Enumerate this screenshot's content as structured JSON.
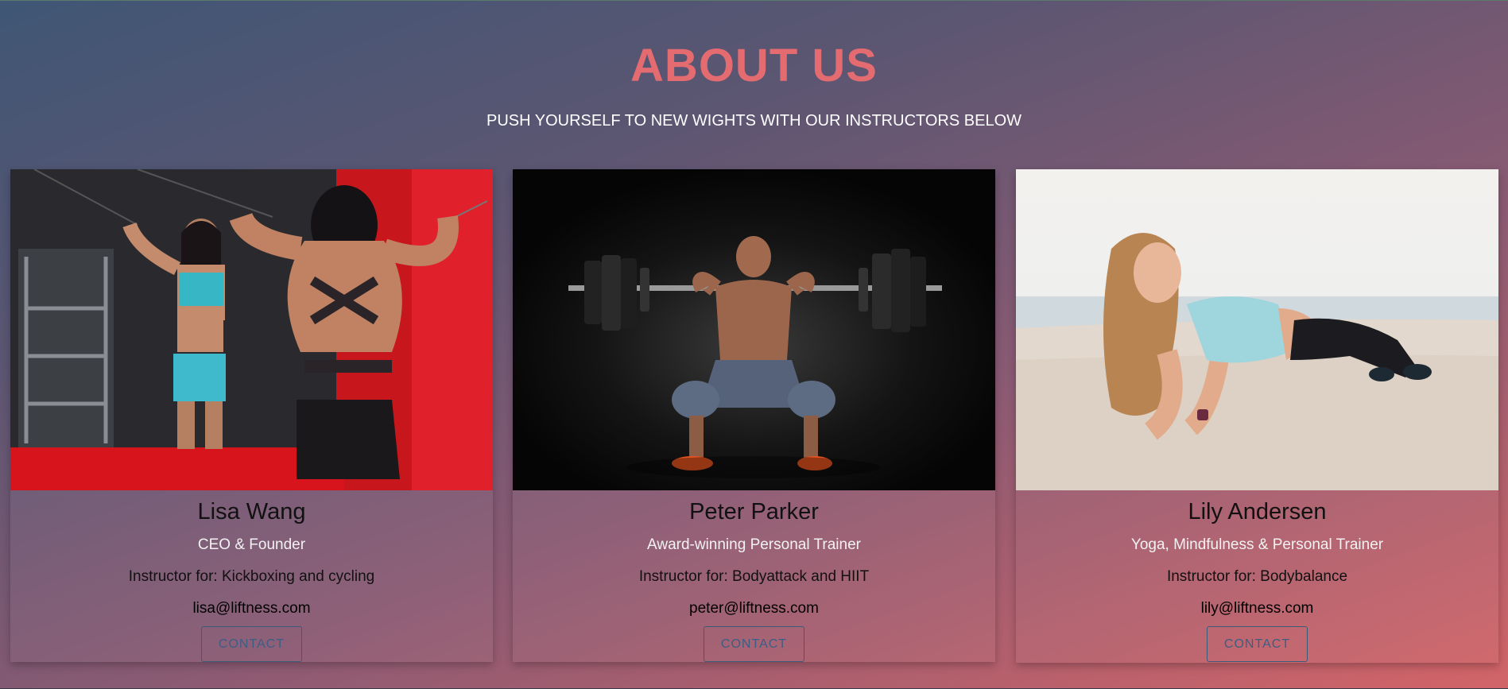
{
  "header": {
    "title": "ABOUT US",
    "subtitle": "PUSH YOURSELF TO NEW WIGHTS WITH OUR INSTRUCTORS BELOW"
  },
  "instructors": [
    {
      "name": "Lisa Wang",
      "role": "CEO & Founder",
      "classes": "Instructor for: Kickboxing and cycling",
      "email": "lisa@liftness.com",
      "button_label": "CONTACT"
    },
    {
      "name": "Peter Parker",
      "role": "Award-winning Personal Trainer",
      "classes": "Instructor for: Bodyattack and HIIT",
      "email": "peter@liftness.com",
      "button_label": "CONTACT"
    },
    {
      "name": "Lily Andersen",
      "role": "Yoga, Mindfulness & Personal Trainer",
      "classes": "Instructor for: Bodybalance",
      "email": "lily@liftness.com",
      "button_label": "CONTACT"
    }
  ],
  "colors": {
    "title": "#e46b70",
    "button_text": "#3d5d84"
  }
}
